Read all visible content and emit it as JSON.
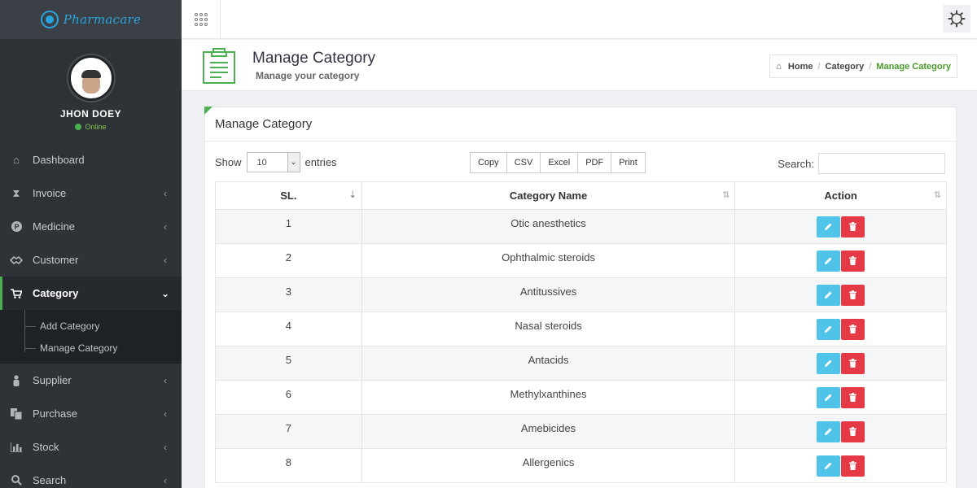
{
  "brand": {
    "name": "Pharmacare"
  },
  "user": {
    "name": "JHON DOEY",
    "status": "Online"
  },
  "sidebar": {
    "items": [
      {
        "label": "Dashboard",
        "icon": "home-icon",
        "caret": ""
      },
      {
        "label": "Invoice",
        "icon": "hourglass-icon",
        "caret": "‹"
      },
      {
        "label": "Medicine",
        "icon": "pill-p-icon",
        "caret": "‹"
      },
      {
        "label": "Customer",
        "icon": "handshake-icon",
        "caret": "‹"
      },
      {
        "label": "Category",
        "icon": "cart-icon",
        "caret": "⌄"
      },
      {
        "label": "Supplier",
        "icon": "person-icon",
        "caret": "‹"
      },
      {
        "label": "Purchase",
        "icon": "files-icon",
        "caret": "‹"
      },
      {
        "label": "Stock",
        "icon": "bar-chart-icon",
        "caret": "‹"
      },
      {
        "label": "Search",
        "icon": "search-icon",
        "caret": "‹"
      }
    ],
    "submenu": [
      {
        "label": "Add Category"
      },
      {
        "label": "Manage Category"
      }
    ]
  },
  "header": {
    "title": "Manage Category",
    "subtitle": "Manage your category",
    "breadcrumb": [
      "Home",
      "Category",
      "Manage Category"
    ]
  },
  "card": {
    "title": "Manage Category",
    "show_label": "Show",
    "entries_value": "10",
    "entries_label": "entries",
    "export_buttons": [
      "Copy",
      "CSV",
      "Excel",
      "PDF",
      "Print"
    ],
    "search_label": "Search:",
    "search_value": ""
  },
  "table": {
    "columns": [
      "SL.",
      "Category Name",
      "Action"
    ],
    "rows": [
      {
        "sl": "1",
        "name": "Otic anesthetics"
      },
      {
        "sl": "2",
        "name": "Ophthalmic steroids"
      },
      {
        "sl": "3",
        "name": "Antitussives"
      },
      {
        "sl": "4",
        "name": "Nasal steroids"
      },
      {
        "sl": "5",
        "name": "Antacids"
      },
      {
        "sl": "6",
        "name": "Methylxanthines"
      },
      {
        "sl": "7",
        "name": "Amebicides"
      },
      {
        "sl": "8",
        "name": "Allergenics"
      }
    ]
  },
  "colors": {
    "accent": "#4caf50",
    "edit": "#4fc3e8",
    "delete": "#e63946",
    "sidebar": "#2e3338"
  }
}
